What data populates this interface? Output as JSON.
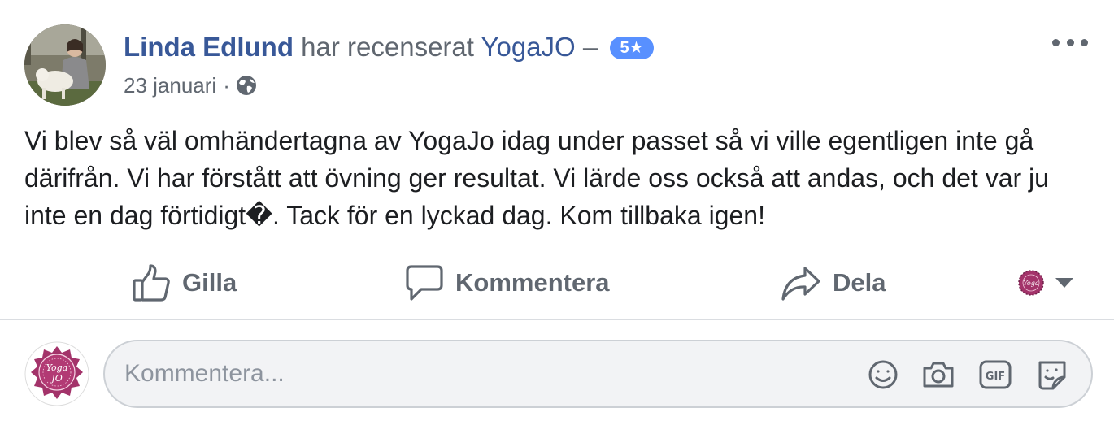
{
  "post": {
    "author_name": "Linda Edlund",
    "verb": "har recenserat",
    "page_name": "YogaJO",
    "dash": "–",
    "rating_label": "5★",
    "date": "23 januari",
    "separator": "·",
    "text": "Vi blev så väl omhändertagna av YogaJo idag under passet så vi ville egentligen inte gå därifrån. Vi har förstått att övning ger resultat. Vi lärde oss också att andas, och det var ju inte en dag förtidigt�. Tack för en lyckad dag. Kom tillbaka igen!"
  },
  "actions": {
    "like_label": "Gilla",
    "comment_label": "Kommentera",
    "share_label": "Dela"
  },
  "composer": {
    "placeholder": "Kommentera...",
    "gif_label": "GIF"
  },
  "brand": {
    "logo_text": "YogaJO",
    "logo_color": "#a3336a",
    "link_color": "#385898",
    "badge_color": "#5890ff"
  },
  "icons": [
    "globe-icon",
    "more-options-icon",
    "thumbs-up-icon",
    "comment-bubble-icon",
    "share-arrow-icon",
    "caret-down-icon",
    "emoji-icon",
    "camera-icon",
    "gif-icon",
    "sticker-icon"
  ]
}
